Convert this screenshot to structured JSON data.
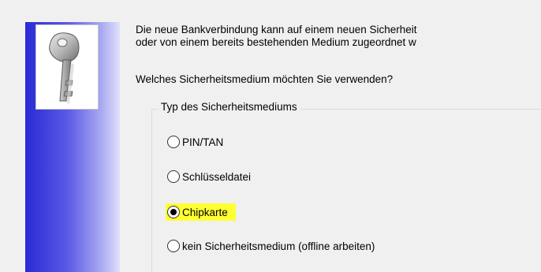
{
  "dialog": {
    "intro_line1": "Die neue Bankverbindung kann  auf einem neuen Sicherheit",
    "intro_line2": "oder von einem bereits bestehenden Medium zugeordnet w",
    "question": "Welches Sicherheitsmedium möchten Sie verwenden?",
    "group_title": "Typ des Sicherheitsmediums",
    "options": [
      {
        "label": "PIN/TAN",
        "selected": false
      },
      {
        "label": "Schlüsseldatei",
        "selected": false
      },
      {
        "label": "Chipkarte",
        "selected": true,
        "highlighted": true
      },
      {
        "label": "kein Sicherheitsmedium (offline arbeiten)",
        "selected": false
      }
    ]
  },
  "banner": {
    "icon": "key-icon",
    "gradient_start": "#2a2ad6",
    "gradient_end": "#e0e0fa"
  },
  "colors": {
    "highlight": "#ffff33",
    "background": "#f0f0f0"
  }
}
